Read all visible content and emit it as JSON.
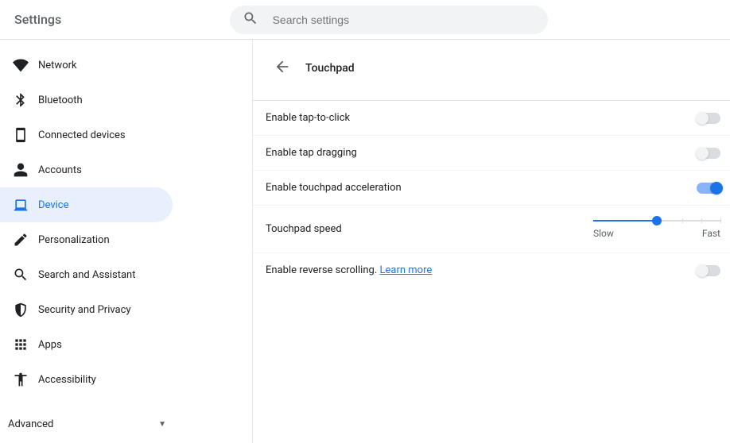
{
  "header": {
    "title": "Settings",
    "search_placeholder": "Search settings"
  },
  "sidebar": {
    "items": [
      {
        "icon": "wifi-icon",
        "label": "Network"
      },
      {
        "icon": "bluetooth-icon",
        "label": "Bluetooth"
      },
      {
        "icon": "phone-icon",
        "label": "Connected devices"
      },
      {
        "icon": "person-icon",
        "label": "Accounts"
      },
      {
        "icon": "laptop-icon",
        "label": "Device",
        "active": true
      },
      {
        "icon": "pencil-icon",
        "label": "Personalization"
      },
      {
        "icon": "search-icon",
        "label": "Search and Assistant"
      },
      {
        "icon": "shield-icon",
        "label": "Security and Privacy"
      },
      {
        "icon": "apps-icon",
        "label": "Apps"
      },
      {
        "icon": "accessibility-icon",
        "label": "Accessibility"
      }
    ],
    "advanced_label": "Advanced"
  },
  "panel": {
    "title": "Touchpad",
    "rows": {
      "tap_to_click": {
        "label": "Enable tap-to-click",
        "on": false
      },
      "tap_dragging": {
        "label": "Enable tap dragging",
        "on": false
      },
      "acceleration": {
        "label": "Enable touchpad acceleration",
        "on": true
      },
      "speed": {
        "label": "Touchpad speed",
        "slow_label": "Slow",
        "fast_label": "Fast",
        "value_percent": 50
      },
      "reverse_scroll": {
        "label_prefix": "Enable reverse scrolling. ",
        "learn_more": "Learn more",
        "on": false
      }
    }
  }
}
